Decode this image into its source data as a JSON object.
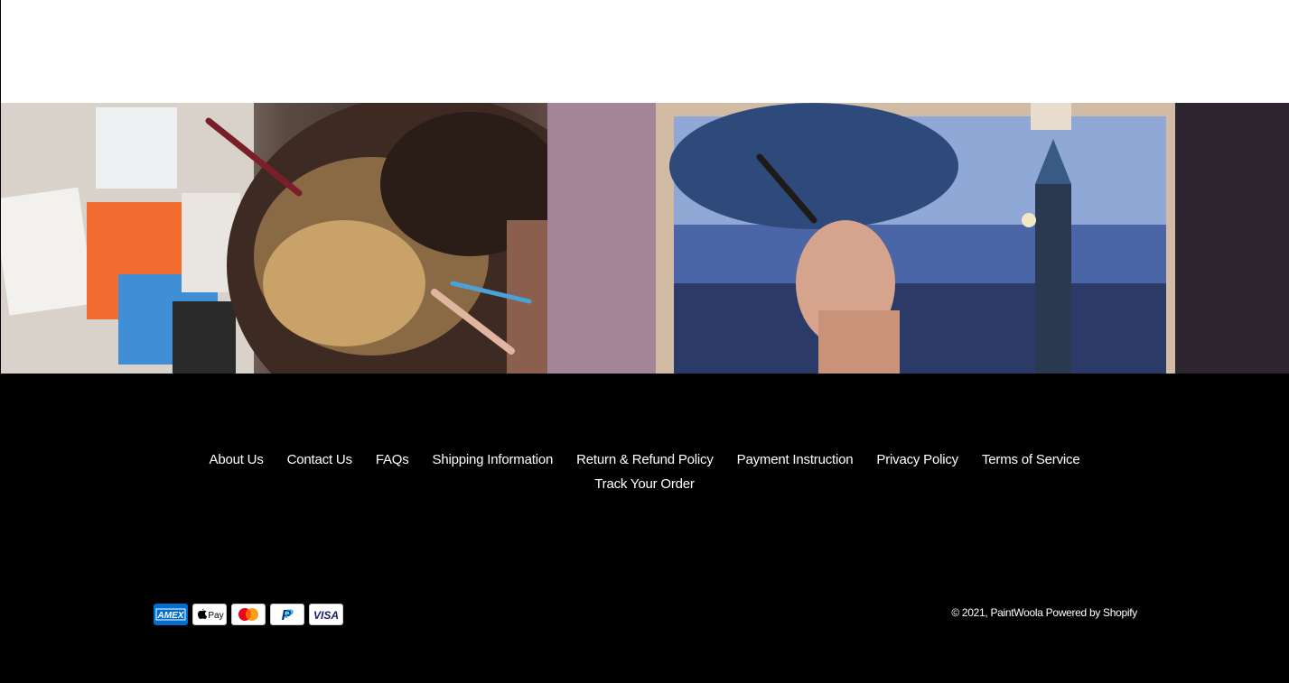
{
  "hero": {
    "image_alt": "painting-by-numbers-hero-image"
  },
  "footer": {
    "links_row1": [
      {
        "label": "About Us",
        "name": "footer-link-about-us"
      },
      {
        "label": "Contact Us",
        "name": "footer-link-contact-us"
      },
      {
        "label": "FAQs",
        "name": "footer-link-faqs"
      },
      {
        "label": "Shipping Information",
        "name": "footer-link-shipping-information"
      },
      {
        "label": "Return & Refund Policy",
        "name": "footer-link-return-refund-policy"
      },
      {
        "label": "Payment Instruction",
        "name": "footer-link-payment-instruction"
      },
      {
        "label": "Privacy Policy",
        "name": "footer-link-privacy-policy"
      },
      {
        "label": "Terms of Service",
        "name": "footer-link-terms-of-service"
      }
    ],
    "links_row2": [
      {
        "label": "Track Your Order",
        "name": "footer-link-track-your-order"
      }
    ],
    "payment_methods": [
      {
        "name": "amex-icon",
        "label": "AMEX",
        "color": "#016fd0"
      },
      {
        "name": "apple-pay-icon",
        "label": "Pay",
        "color": "#000000"
      },
      {
        "name": "mastercard-icon",
        "label": "mastercard",
        "color": "#eb001b"
      },
      {
        "name": "paypal-icon",
        "label": "P",
        "color": "#003087"
      },
      {
        "name": "visa-icon",
        "label": "VISA",
        "color": "#1a1f71"
      }
    ],
    "copyright_prefix": "© 2021, ",
    "store_name": "PaintWoola",
    "powered_by": "Powered by Shopify"
  }
}
